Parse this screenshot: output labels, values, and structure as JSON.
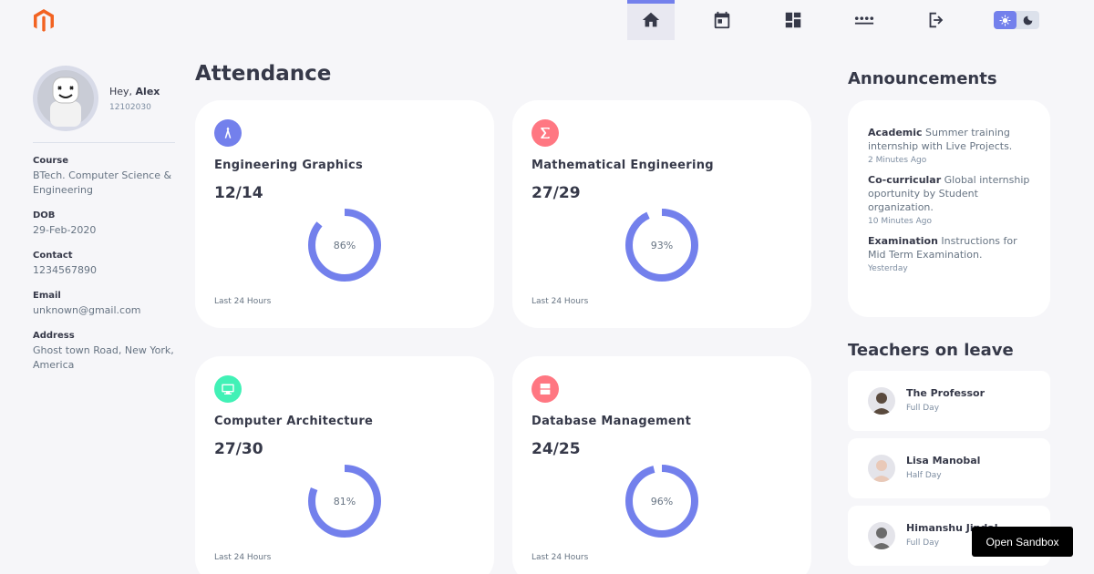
{
  "header": {
    "nav": [
      {
        "icon": "home-icon",
        "active": true
      },
      {
        "icon": "calendar-icon",
        "active": false
      },
      {
        "icon": "grid-icon",
        "active": false
      },
      {
        "icon": "more-dots-icon",
        "active": false
      },
      {
        "icon": "logout-icon",
        "active": false
      }
    ],
    "theme": {
      "light_icon": "sun-icon",
      "dark_icon": "moon-icon",
      "selected": "light"
    }
  },
  "profile": {
    "greeting": "Hey,",
    "name": "Alex",
    "roll": "12102030",
    "fields": [
      {
        "label": "Course",
        "value": "BTech. Computer Science & Engineering"
      },
      {
        "label": "DOB",
        "value": "29-Feb-2020"
      },
      {
        "label": "Contact",
        "value": "1234567890"
      },
      {
        "label": "Email",
        "value": "unknown@gmail.com"
      },
      {
        "label": "Address",
        "value": "Ghost town Road, New York, America"
      }
    ]
  },
  "attendance": {
    "title": "Attendance",
    "cards": [
      {
        "subject": "Engineering Graphics",
        "fraction": "12/14",
        "percent_label": "86%",
        "percent": 86,
        "footer": "Last 24 Hours",
        "icon": "compass-icon",
        "color": "#7380ec"
      },
      {
        "subject": "Mathematical Engineering",
        "fraction": "27/29",
        "percent_label": "93%",
        "percent": 93,
        "footer": "Last 24 Hours",
        "icon": "sigma-icon",
        "color": "#ff7782"
      },
      {
        "subject": "Computer Architecture",
        "fraction": "27/30",
        "percent_label": "81%",
        "percent": 81,
        "footer": "Last 24 Hours",
        "icon": "computer-icon",
        "color": "#41f1b6"
      },
      {
        "subject": "Database Management",
        "fraction": "24/25",
        "percent_label": "96%",
        "percent": 96,
        "footer": "Last 24 Hours",
        "icon": "database-icon",
        "color": "#ff7782"
      }
    ]
  },
  "announcements": {
    "title": "Announcements",
    "items": [
      {
        "category": "Academic",
        "text": " Summer training internship with Live Projects.",
        "time": "2 Minutes Ago"
      },
      {
        "category": "Co-curricular",
        "text": " Global internship oportunity by Student organization.",
        "time": "10 Minutes Ago"
      },
      {
        "category": "Examination",
        "text": " Instructions for Mid Term Examination.",
        "time": "Yesterday"
      }
    ]
  },
  "leave": {
    "title": "Teachers on leave",
    "teachers": [
      {
        "name": "The Professor",
        "duration": "Full Day"
      },
      {
        "name": "Lisa Manobal",
        "duration": "Half Day"
      },
      {
        "name": "Himanshu Jindal",
        "duration": "Full Day"
      }
    ]
  },
  "sandbox_label": "Open Sandbox",
  "ring_color": "#7380ec"
}
